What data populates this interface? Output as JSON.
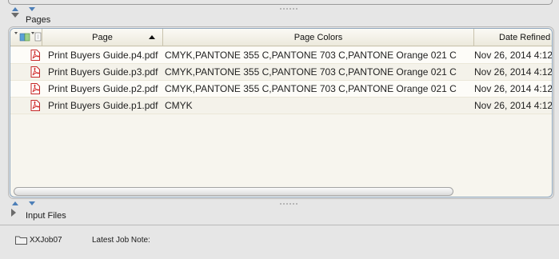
{
  "pages_section": {
    "title": "Pages"
  },
  "table": {
    "columns": [
      "Page",
      "Page Colors",
      "Date Refined"
    ],
    "rows": [
      {
        "page": "Print Buyers Guide.p4.pdf",
        "colors": "CMYK,PANTONE 355 C,PANTONE 703 C,PANTONE Orange 021 C",
        "date": "Nov 26, 2014 4:12"
      },
      {
        "page": "Print Buyers Guide.p3.pdf",
        "colors": "CMYK,PANTONE 355 C,PANTONE 703 C,PANTONE Orange 021 C",
        "date": "Nov 26, 2014 4:12"
      },
      {
        "page": "Print Buyers Guide.p2.pdf",
        "colors": "CMYK,PANTONE 355 C,PANTONE 703 C,PANTONE Orange 021 C",
        "date": "Nov 26, 2014 4:12"
      },
      {
        "page": "Print Buyers Guide.p1.pdf",
        "colors": "CMYK",
        "date": "Nov 26, 2014 4:12"
      }
    ]
  },
  "input_files_section": {
    "title": "Input Files"
  },
  "status": {
    "job_name": "XXJob07",
    "job_note_label": "Latest Job Note:"
  },
  "colors": {
    "accent": "#4d7fb8",
    "pdf_red": "#d32f2f",
    "table_border": "#8ea6bd"
  }
}
